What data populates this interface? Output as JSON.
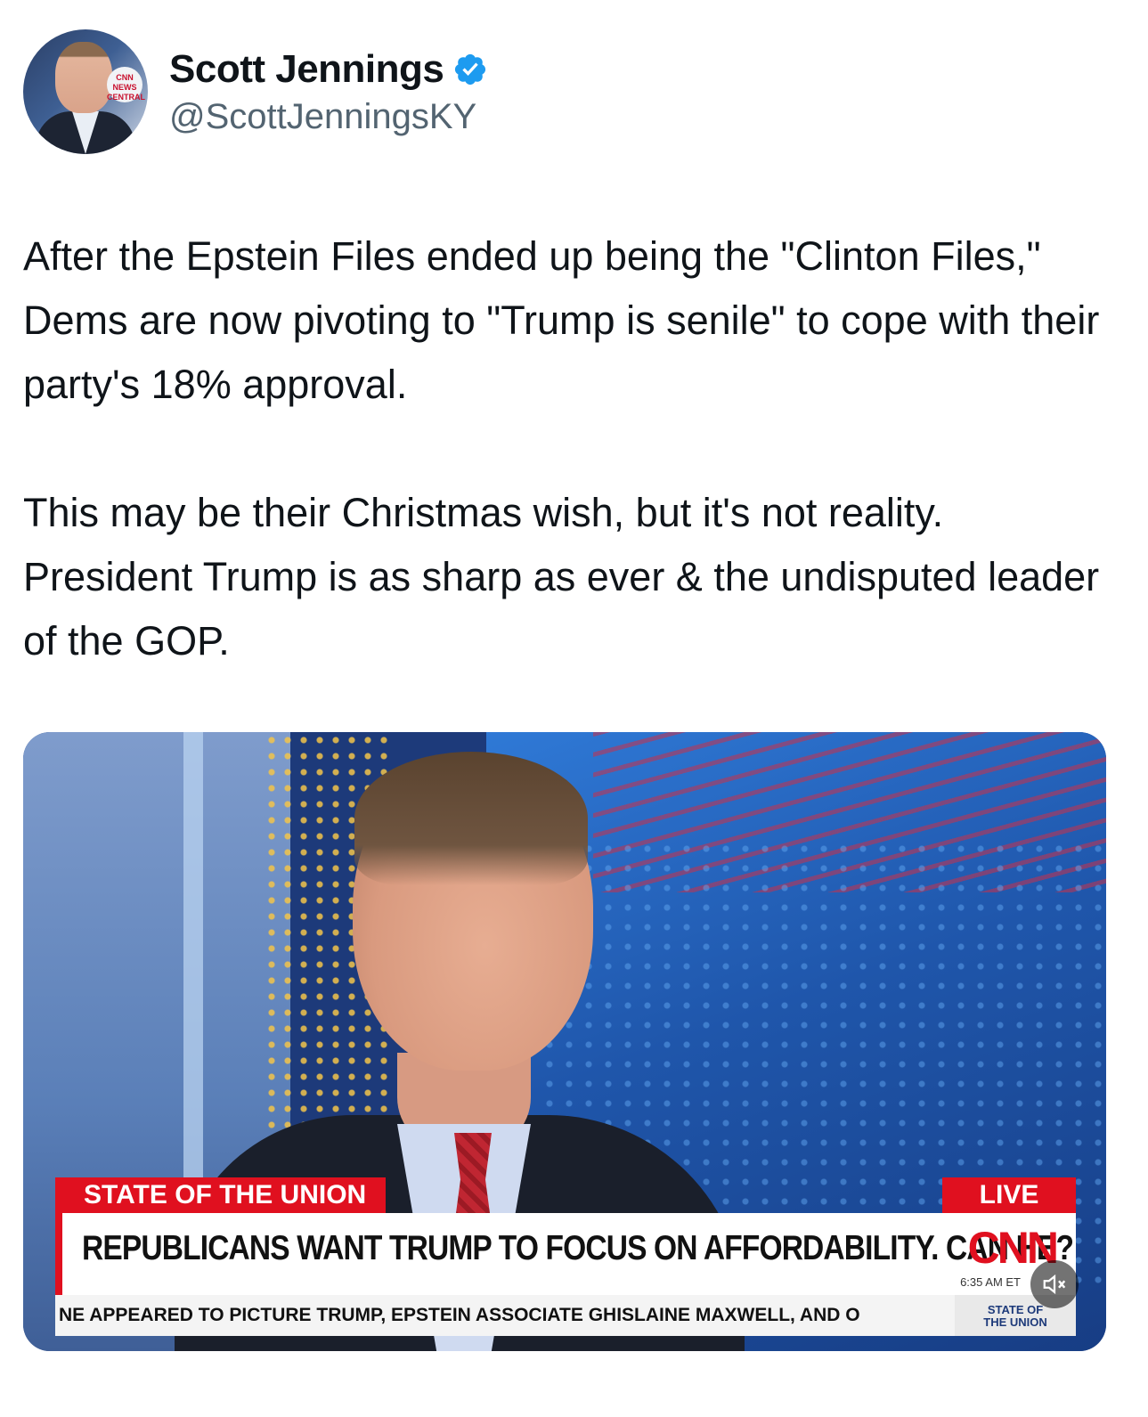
{
  "author": {
    "display_name": "Scott Jennings",
    "handle": "@ScottJenningsKY",
    "avatar_logo_text": "CNN NEWS CENTRAL",
    "verified_color": "#1d9bf0"
  },
  "tweet": {
    "text": "After the Epstein Files ended up being the \"Clinton Files,\" Dems are now pivoting to \"Trump is senile\" to cope with their party's 18% approval.\n\nThis may be their Christmas wish, but it's not reality. President Trump is as sharp as ever & the undisputed leader of the GOP."
  },
  "media": {
    "show_tag": "STATE OF THE UNION",
    "live_tag": "LIVE",
    "headline": "REPUBLICANS WANT TRUMP TO FOCUS ON AFFORDABILITY. CAN HE?",
    "network_logo": "CNN",
    "clock": "6:35 AM ET",
    "ticker": "NE APPEARED TO PICTURE TRUMP, EPSTEIN ASSOCIATE GHISLAINE MAXWELL, AND O",
    "ticker_brand_line1": "STATE OF",
    "ticker_brand_line2": "THE UNION",
    "mute_icon": "speaker-muted-icon",
    "accent_red": "#e0101f"
  }
}
